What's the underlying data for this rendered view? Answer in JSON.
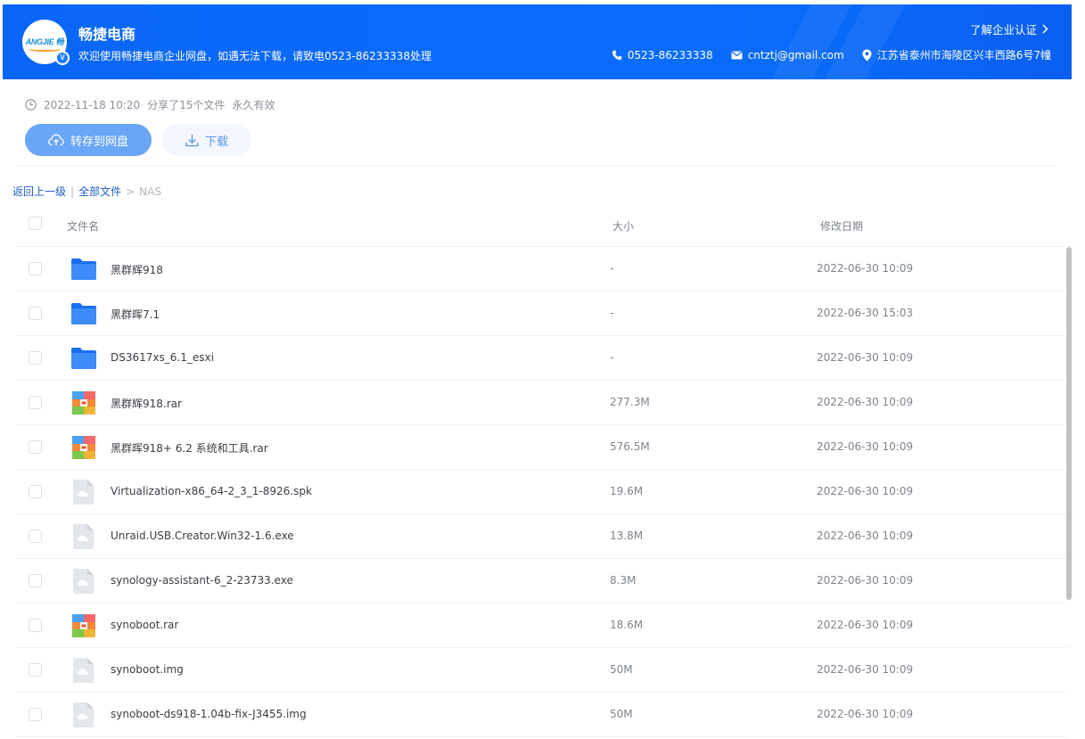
{
  "header": {
    "logo_text": "ANGJIE 畅",
    "verified_badge": "V",
    "title": "畅捷电商",
    "subtitle": "欢迎使用畅捷电商企业网盘，如遇无法下载，请致电0523-86233338处理",
    "cert_link": "了解企业认证",
    "phone": "0523-86233338",
    "email": "cntztj@gmail.com",
    "address": "江苏省泰州市海陵区兴丰西路6号7幢",
    "colors": {
      "bar": "#0a66f7",
      "save_button": "#6aa6f7"
    }
  },
  "share": {
    "time": "2022-11-18 10:20",
    "count": "分享了15个文件",
    "validity": "永久有效",
    "save_label": "转存到网盘",
    "download_label": "下载"
  },
  "breadcrumb": {
    "back": "返回上一级",
    "separator": "|",
    "all": "全部文件",
    "arrow": ">",
    "current": "NAS"
  },
  "table": {
    "col_name": "文件名",
    "col_size": "大小",
    "col_date": "修改日期",
    "rows": [
      {
        "name": "黑群辉918",
        "size": "-",
        "date": "2022-06-30 10:09",
        "icon": "folder-icon"
      },
      {
        "name": "黑群晖7.1",
        "size": "-",
        "date": "2022-06-30 15:03",
        "icon": "folder-icon"
      },
      {
        "name": "DS3617xs_6.1_esxi",
        "size": "-",
        "date": "2022-06-30 10:09",
        "icon": "folder-icon"
      },
      {
        "name": "黑群辉918.rar",
        "size": "277.3M",
        "date": "2022-06-30 10:09",
        "icon": "archive-icon"
      },
      {
        "name": "黑群晖918+ 6.2 系统和工具.rar",
        "size": "576.5M",
        "date": "2022-06-30 10:09",
        "icon": "archive-icon"
      },
      {
        "name": "Virtualization-x86_64-2_3_1-8926.spk",
        "size": "19.6M",
        "date": "2022-06-30 10:09",
        "icon": "generic-file-icon"
      },
      {
        "name": "Unraid.USB.Creator.Win32-1.6.exe",
        "size": "13.8M",
        "date": "2022-06-30 10:09",
        "icon": "generic-file-icon"
      },
      {
        "name": "synology-assistant-6_2-23733.exe",
        "size": "8.3M",
        "date": "2022-06-30 10:09",
        "icon": "generic-file-icon"
      },
      {
        "name": "synoboot.rar",
        "size": "18.6M",
        "date": "2022-06-30 10:09",
        "icon": "archive-icon"
      },
      {
        "name": "synoboot.img",
        "size": "50M",
        "date": "2022-06-30 10:09",
        "icon": "generic-file-icon"
      },
      {
        "name": "synoboot-ds918-1.04b-fix-J3455.img",
        "size": "50M",
        "date": "2022-06-30 10:09",
        "icon": "generic-file-icon"
      }
    ]
  }
}
